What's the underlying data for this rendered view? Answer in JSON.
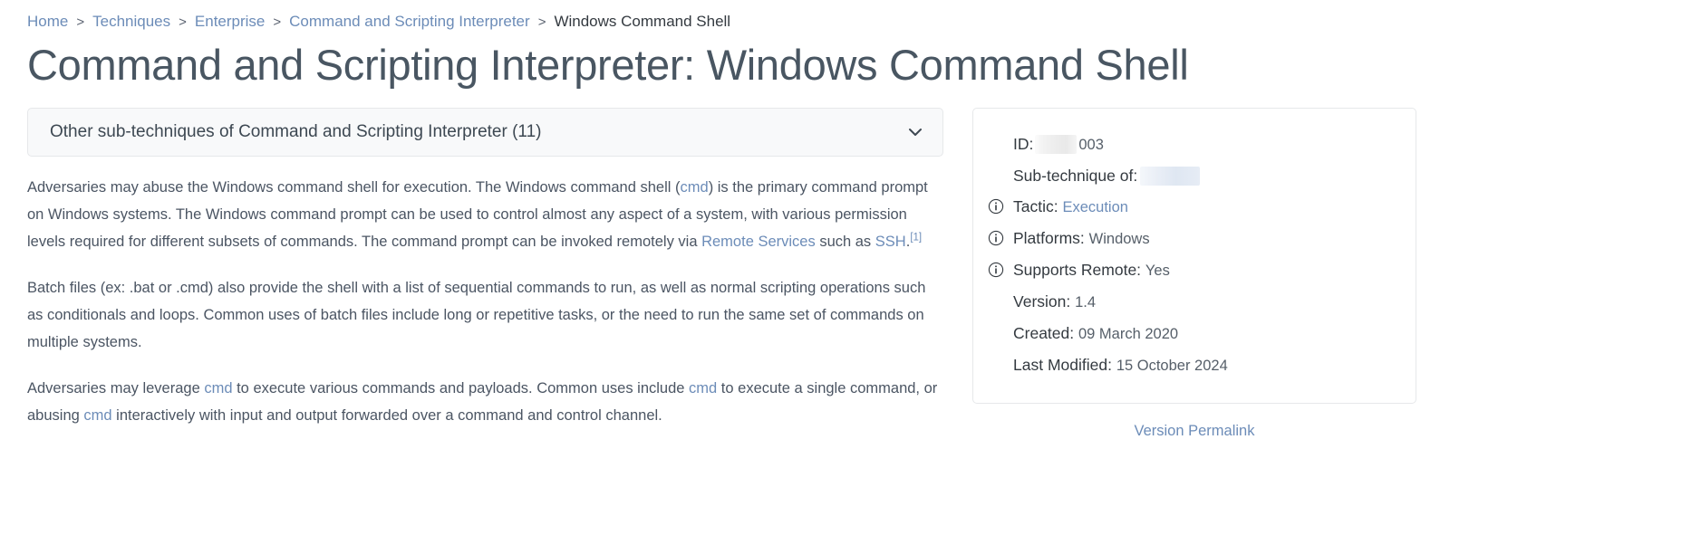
{
  "breadcrumb": {
    "separator": ">",
    "items": [
      {
        "label": "Home",
        "link": true
      },
      {
        "label": "Techniques",
        "link": true
      },
      {
        "label": "Enterprise",
        "link": true
      },
      {
        "label": "Command and Scripting Interpreter",
        "link": true
      },
      {
        "label": "Windows Command Shell",
        "link": false
      }
    ]
  },
  "page_title": "Command and Scripting Interpreter: Windows Command Shell",
  "accordion": {
    "label": "Other sub-techniques of Command and Scripting Interpreter (11)",
    "icon": "chevron-down-icon",
    "expanded": false
  },
  "paragraphs": [
    {
      "id": "p1",
      "parts": [
        {
          "t": "text",
          "v": "Adversaries may abuse the Windows command shell for execution. The Windows command shell ("
        },
        {
          "t": "link",
          "v": "cmd"
        },
        {
          "t": "text",
          "v": ") is the primary command prompt on Windows systems. The Windows command prompt can be used to control almost any aspect of a system, with various permission levels required for different subsets of commands. The command prompt can be invoked remotely via "
        },
        {
          "t": "link",
          "v": "Remote Services"
        },
        {
          "t": "text",
          "v": " such as "
        },
        {
          "t": "link",
          "v": "SSH"
        },
        {
          "t": "text",
          "v": "."
        },
        {
          "t": "cite",
          "v": "[1]"
        }
      ]
    },
    {
      "id": "p2",
      "parts": [
        {
          "t": "text",
          "v": "Batch files (ex: .bat or .cmd) also provide the shell with a list of sequential commands to run, as well as normal scripting operations such as conditionals and loops. Common uses of batch files include long or repetitive tasks, or the need to run the same set of commands on multiple systems."
        }
      ]
    },
    {
      "id": "p3",
      "parts": [
        {
          "t": "text",
          "v": "Adversaries may leverage "
        },
        {
          "t": "link",
          "v": "cmd"
        },
        {
          "t": "text",
          "v": " to execute various commands and payloads. Common uses include "
        },
        {
          "t": "link",
          "v": "cmd"
        },
        {
          "t": "text",
          "v": " to execute a single command, or abusing "
        },
        {
          "t": "link",
          "v": "cmd"
        },
        {
          "t": "text",
          "v": " interactively with input and output forwarded over a command and control channel."
        }
      ]
    }
  ],
  "info_card": {
    "rows": [
      {
        "key": "ID:",
        "value": "003",
        "redacted": "id",
        "info": false,
        "value_is_link": false
      },
      {
        "key": "Sub-technique of:",
        "value": "",
        "redacted": "sub",
        "info": false,
        "value_is_link": false
      },
      {
        "key": "Tactic:",
        "value": "Execution",
        "redacted": null,
        "info": true,
        "value_is_link": true
      },
      {
        "key": "Platforms:",
        "value": "Windows",
        "redacted": null,
        "info": true,
        "value_is_link": false
      },
      {
        "key": "Supports Remote:",
        "value": "Yes",
        "redacted": null,
        "info": true,
        "value_is_link": false
      },
      {
        "key": "Version:",
        "value": "1.4",
        "redacted": null,
        "info": false,
        "value_is_link": false
      },
      {
        "key": "Created:",
        "value": "09 March 2020",
        "redacted": null,
        "info": false,
        "value_is_link": false
      },
      {
        "key": "Last Modified:",
        "value": "15 October 2024",
        "redacted": null,
        "info": false,
        "value_is_link": false
      }
    ],
    "info_icon": "info-circle-icon"
  },
  "permalink": {
    "label": "Version Permalink"
  },
  "colors": {
    "link": "#6c8cb8",
    "title": "#495662",
    "body_text": "#4b5563",
    "card_border": "#e6e8ea",
    "accordion_bg": "#f8f9fa"
  }
}
